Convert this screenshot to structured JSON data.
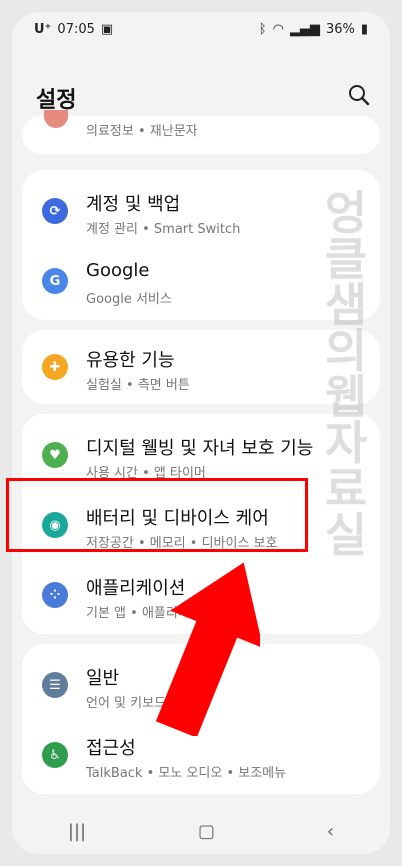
{
  "status": {
    "carrier": "U⁺",
    "time": "07:05",
    "battery": "36%"
  },
  "page_title": "설정",
  "partial_item": {
    "subtitle": "의료정보 • 재난문자"
  },
  "groups": [
    {
      "items": [
        {
          "title": "계정 및 백업",
          "subtitle": "계정 관리 • Smart Switch",
          "icon": "sync-icon",
          "color": "#3d6ae0"
        },
        {
          "title": "Google",
          "subtitle": "Google 서비스",
          "icon": "google-icon",
          "color": "#4a86e8"
        }
      ]
    },
    {
      "items": [
        {
          "title": "유용한 기능",
          "subtitle": "실험실 • 측면 버튼",
          "icon": "plus-badge-icon",
          "color": "#f5a623"
        }
      ]
    },
    {
      "items": [
        {
          "title": "디지털 웰빙 및 자녀 보호 기능",
          "subtitle": "사용 시간 • 앱 타이머",
          "icon": "heart-circle-icon",
          "color": "#4caf50"
        },
        {
          "title": "배터리 및 디바이스 케어",
          "subtitle": "저장공간 • 메모리 • 디바이스 보호",
          "icon": "device-care-icon",
          "color": "#19a89a"
        },
        {
          "title": "애플리케이션",
          "subtitle": "기본 앱 • 애플리케이",
          "icon": "apps-grid-icon",
          "color": "#4a7bd8"
        }
      ]
    },
    {
      "items": [
        {
          "title": "일반",
          "subtitle": "언어 및 키보드 • 날짜",
          "icon": "sliders-icon",
          "color": "#607d9b"
        },
        {
          "title": "접근성",
          "subtitle": "TalkBack • 모노 오디오 • 보조메뉴",
          "icon": "accessibility-icon",
          "color": "#2e9d4e"
        }
      ]
    }
  ],
  "watermark": "엉클샘의웹자료실",
  "colors": {
    "highlight": "#ff0000",
    "arrow": "#ff0000"
  }
}
